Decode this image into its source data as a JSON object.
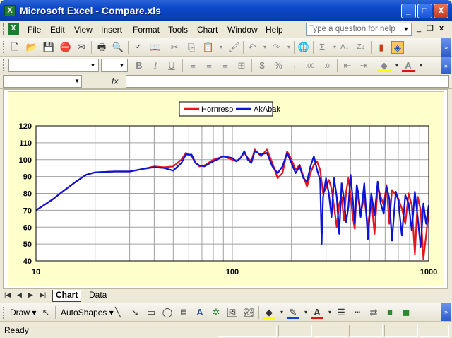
{
  "window": {
    "title": "Microsoft Excel - Compare.xls",
    "app_icon": "excel-icon",
    "minimize": "_",
    "maximize": "□",
    "close": "X"
  },
  "menubar": {
    "items": [
      "File",
      "Edit",
      "View",
      "Insert",
      "Format",
      "Tools",
      "Chart",
      "Window",
      "Help"
    ],
    "ask_placeholder": "Type a question for help",
    "doc_min": "_",
    "doc_restore": "❐",
    "doc_close": "x"
  },
  "formula_bar": {
    "fx_label": "fx",
    "name_value": "",
    "formula_value": ""
  },
  "format_toolbar": {
    "bold": "B",
    "italic": "I",
    "underline": "U",
    "currency": "$",
    "percent": "%"
  },
  "sheet_tabs": {
    "tabs": [
      "Chart",
      "Data"
    ],
    "active": "Chart"
  },
  "draw_toolbar": {
    "draw_label": "Draw ▾",
    "autoshapes_label": "AutoShapes ▾"
  },
  "status": {
    "text": "Ready"
  },
  "colors": {
    "hornresp": "#e8141c",
    "akabak": "#0a14d8",
    "chart_bg": "#ffffcc"
  },
  "chart_data": {
    "type": "line",
    "title": "",
    "xlabel": "",
    "ylabel": "",
    "x_scale": "log",
    "xlim": [
      10,
      1000
    ],
    "ylim": [
      40,
      120
    ],
    "x_ticks": [
      "10",
      "100",
      "1000"
    ],
    "y_ticks": [
      "40",
      "50",
      "60",
      "70",
      "80",
      "90",
      "100",
      "110",
      "120"
    ],
    "grid": true,
    "legend_position": "top-center",
    "series": [
      {
        "name": "Hornresp",
        "color": "#e8141c",
        "x": [
          10,
          12,
          14,
          16,
          18,
          20,
          25,
          30,
          35,
          40,
          45,
          50,
          55,
          58,
          62,
          65,
          68,
          72,
          80,
          90,
          100,
          105,
          110,
          115,
          120,
          125,
          130,
          140,
          150,
          160,
          170,
          180,
          190,
          200,
          210,
          220,
          230,
          240,
          250,
          260,
          270,
          280,
          290,
          300,
          310,
          320,
          330,
          340,
          350,
          360,
          370,
          380,
          390,
          400,
          410,
          420,
          430,
          440,
          450,
          470,
          490,
          510,
          530,
          550,
          570,
          590,
          610,
          630,
          650,
          680,
          700,
          730,
          760,
          790,
          820,
          850,
          880,
          910,
          940,
          970,
          1000
        ],
        "y": [
          70,
          76,
          82,
          87,
          91,
          92.5,
          93,
          93,
          94.5,
          96,
          95.5,
          96,
          100,
          104,
          102,
          98,
          96,
          96.5,
          100,
          102,
          100,
          99,
          101,
          104,
          101,
          99,
          106,
          102,
          106,
          98,
          89,
          92,
          105,
          100,
          94,
          97,
          90,
          84,
          92,
          97,
          99,
          94,
          80,
          83,
          88,
          83,
          72,
          60,
          74,
          78,
          64,
          81,
          89,
          79,
          66,
          59,
          83,
          75,
          68,
          78,
          60,
          77,
          56,
          84,
          78,
          73,
          85,
          62,
          82,
          79,
          77,
          71,
          62,
          80,
          73,
          44,
          78,
          70,
          41,
          55,
          70
        ]
      },
      {
        "name": "AkAbak",
        "color": "#0a14d8",
        "x": [
          10,
          12,
          14,
          16,
          18,
          20,
          25,
          30,
          35,
          40,
          45,
          50,
          55,
          58,
          62,
          65,
          68,
          72,
          80,
          90,
          100,
          105,
          110,
          115,
          120,
          125,
          130,
          140,
          150,
          160,
          170,
          180,
          190,
          200,
          210,
          220,
          230,
          240,
          250,
          260,
          270,
          280,
          285,
          290,
          300,
          310,
          320,
          330,
          340,
          350,
          360,
          370,
          380,
          390,
          400,
          410,
          420,
          430,
          440,
          450,
          470,
          490,
          510,
          530,
          550,
          570,
          590,
          610,
          630,
          650,
          680,
          700,
          730,
          760,
          790,
          820,
          850,
          880,
          910,
          940,
          970,
          1000
        ],
        "y": [
          70,
          76,
          82,
          87,
          91,
          92.5,
          93,
          93,
          94.5,
          95.5,
          95,
          93.5,
          98,
          103,
          103,
          98,
          96.5,
          96,
          99,
          102,
          101,
          99,
          101,
          105,
          100,
          98,
          105,
          103,
          104,
          96,
          92,
          96,
          104,
          98,
          92,
          96,
          89,
          87,
          96,
          102,
          94,
          88,
          50,
          78,
          89,
          80,
          66,
          89,
          78,
          56,
          86,
          77,
          63,
          72,
          91,
          77,
          62,
          85,
          79,
          66,
          86,
          53,
          80,
          67,
          87,
          74,
          68,
          84,
          77,
          52,
          81,
          76,
          55,
          79,
          74,
          58,
          81,
          65,
          48,
          74,
          62,
          73
        ]
      }
    ]
  }
}
